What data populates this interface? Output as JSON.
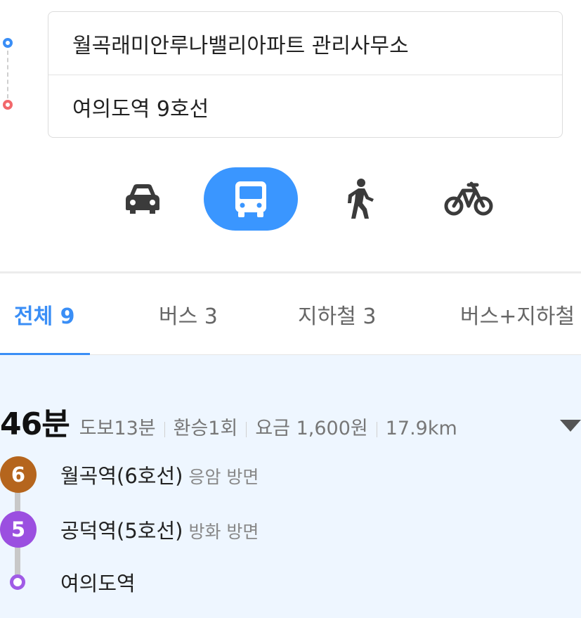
{
  "route": {
    "origin": "월곡래미안루나밸리아파트 관리사무소",
    "destination": "여의도역 9호선"
  },
  "modes": [
    {
      "name": "car-icon",
      "active": false
    },
    {
      "name": "bus-icon",
      "active": true
    },
    {
      "name": "walk-icon",
      "active": false
    },
    {
      "name": "bike-icon",
      "active": false
    }
  ],
  "tabs": [
    {
      "label": "전체 9",
      "active": true
    },
    {
      "label": "버스 3",
      "active": false
    },
    {
      "label": "지하철 3",
      "active": false
    },
    {
      "label": "버스+지하철",
      "active": false
    }
  ],
  "result": {
    "total_time": "46분",
    "walk": "도보13분",
    "transfers": "환승1회",
    "fare": "요금 1,600원",
    "distance": "17.9km",
    "steps": [
      {
        "badge": "6",
        "color": "#b5651d",
        "station": "월곡역(6호선)",
        "direction": "응암 방면"
      },
      {
        "badge": "5",
        "color": "#9b4fe0",
        "station": "공덕역(5호선)",
        "direction": "방화 방면"
      },
      {
        "badge": "",
        "color": "#a05be6",
        "station": "여의도역",
        "direction": ""
      }
    ]
  }
}
